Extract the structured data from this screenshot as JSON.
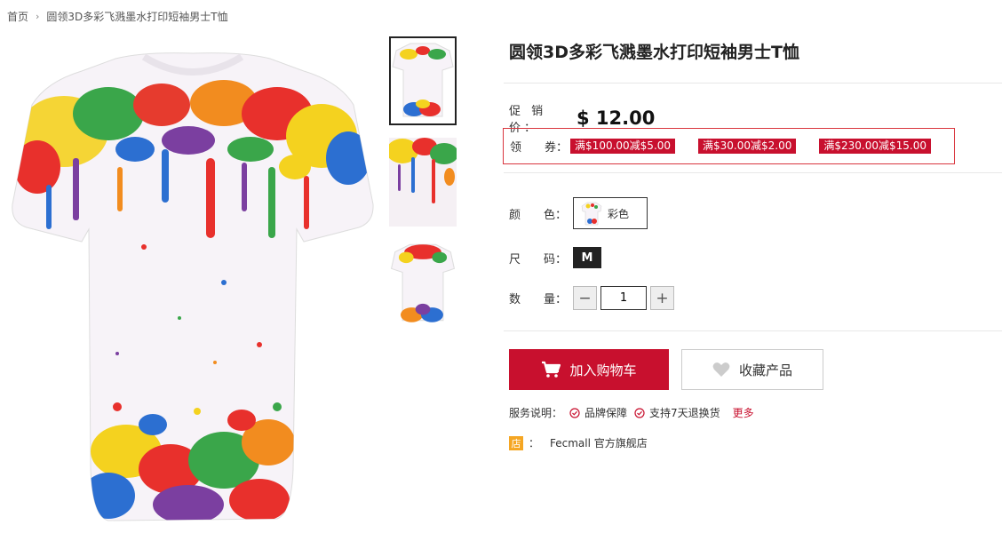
{
  "breadcrumb": {
    "home": "首页",
    "separator": "›",
    "current": "圆领3D多彩飞溅墨水打印短袖男士T恤"
  },
  "product": {
    "title": "圆领3D多彩飞溅墨水打印短袖男士T恤",
    "price_label": "促 销 价：",
    "price": "$ 12.00",
    "coupon_label": "领　　券：",
    "coupons": [
      "满$100.00减$5.00",
      "满$30.00减$2.00",
      "满$230.00减$15.00"
    ],
    "color_label": "颜　　色：",
    "color_value": "彩色",
    "size_label": "尺　　码：",
    "size_value": "M",
    "qty_label": "数　　量：",
    "qty_value": "1",
    "qty_minus": "−",
    "qty_plus": "+"
  },
  "actions": {
    "add_to_cart": "加入购物车",
    "favorite": "收藏产品"
  },
  "service": {
    "label": "服务说明：",
    "items": [
      "品牌保障",
      "支持7天退换货"
    ],
    "more": "更多"
  },
  "shop": {
    "badge": "店",
    "colon": "：",
    "name": "Fecmall 官方旗舰店"
  },
  "colors": {
    "accent": "#c8102e",
    "shop_badge": "#f5a623"
  }
}
